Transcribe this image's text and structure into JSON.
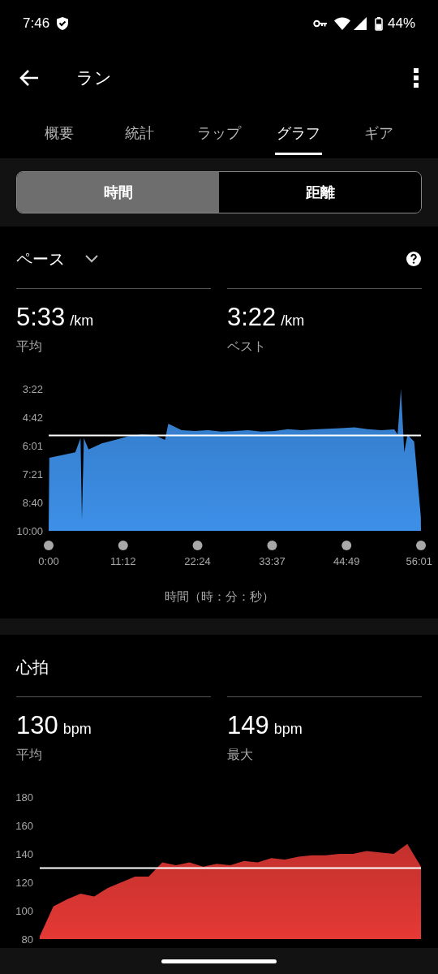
{
  "status_bar": {
    "time": "7:46",
    "battery": "44%"
  },
  "app_bar": {
    "title": "ラン"
  },
  "tabs": [
    {
      "label": "概要",
      "selected": false
    },
    {
      "label": "統計",
      "selected": false
    },
    {
      "label": "ラップ",
      "selected": false
    },
    {
      "label": "グラフ",
      "selected": true
    },
    {
      "label": "ギア",
      "selected": false
    }
  ],
  "segments": [
    {
      "label": "時間",
      "selected": true
    },
    {
      "label": "距離",
      "selected": false
    }
  ],
  "sections": [
    {
      "title": "ペース",
      "dropdown": true,
      "help": true,
      "stats": [
        {
          "value": "5:33",
          "unit": "/km",
          "label": "平均"
        },
        {
          "value": "3:22",
          "unit": "/km",
          "label": "ベスト"
        }
      ],
      "chart_data": {
        "type": "area",
        "xlabel": "時間（時：分：秒）",
        "xlim": [
          0,
          56.02
        ],
        "ylim": [
          600,
          202
        ],
        "x": [
          0,
          0.1,
          2,
          4,
          4.8,
          5,
          5.3,
          6,
          8,
          10,
          12,
          14,
          16,
          17.5,
          18,
          20,
          22,
          24,
          26,
          28,
          30,
          32,
          34,
          36,
          38,
          40,
          42,
          44,
          46,
          48,
          50,
          52,
          52.5,
          53,
          53.5,
          54,
          55,
          56,
          56.02
        ],
        "series": [
          {
            "color": "#3d8fe8",
            "values": [
              600,
              395,
              388,
              380,
              340,
              570,
              340,
              372,
              355,
              345,
              335,
              330,
              332,
              345,
              300,
              318,
              320,
              318,
              322,
              320,
              318,
              322,
              320,
              315,
              318,
              316,
              314,
              312,
              310,
              315,
              318,
              316,
              330,
              202,
              380,
              330,
              350,
              560,
              600
            ]
          }
        ],
        "xticks": [
          {
            "value": 0,
            "label": "0:00"
          },
          {
            "value": 11.2,
            "label": "11:12"
          },
          {
            "value": 22.4,
            "label": "22:24"
          },
          {
            "value": 33.62,
            "label": "33:37"
          },
          {
            "value": 44.82,
            "label": "44:49"
          },
          {
            "value": 56.02,
            "label": "56:01"
          }
        ],
        "yticks": [
          {
            "value": 202,
            "label": "3:22"
          },
          {
            "value": 282,
            "label": "4:42"
          },
          {
            "value": 361,
            "label": "6:01"
          },
          {
            "value": 441,
            "label": "7:21"
          },
          {
            "value": 520,
            "label": "8:40"
          },
          {
            "value": 600,
            "label": "10:00"
          }
        ],
        "ref_lines": [
          {
            "axis": "y",
            "value": 333
          }
        ]
      }
    },
    {
      "title": "心拍",
      "dropdown": false,
      "help": false,
      "stats": [
        {
          "value": "130",
          "unit": "bpm",
          "label": "平均"
        },
        {
          "value": "149",
          "unit": "bpm",
          "label": "最大"
        }
      ],
      "chart_data": {
        "type": "area",
        "ylim": [
          80,
          180
        ],
        "series": [
          {
            "color": "#e53935",
            "values": [
              82,
              103,
              108,
              112,
              110,
              116,
              120,
              124,
              124,
              134,
              132,
              134,
              131,
              133,
              132,
              135,
              134,
              137,
              136,
              138,
              139,
              139,
              140,
              140,
              142,
              141,
              140,
              147,
              131
            ]
          }
        ],
        "yticks": [
          80,
          100,
          120,
          140,
          160,
          180
        ],
        "ref_lines": [
          {
            "axis": "y",
            "value": 130
          }
        ]
      }
    }
  ]
}
